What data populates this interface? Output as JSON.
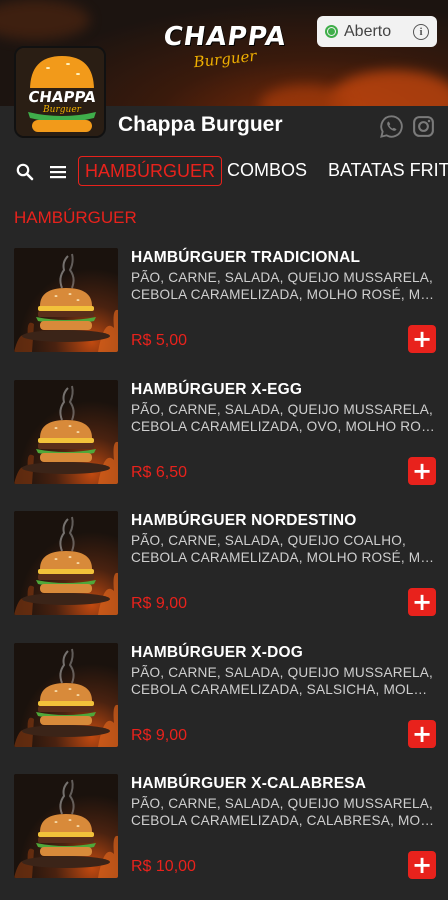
{
  "header": {
    "brand_name": "CHAPPA",
    "brand_sub": "Burguer",
    "status_label": "Aberto",
    "status_icon": "open-dot-icon",
    "store_name": "Chappa Burguer",
    "logo_name": "CHAPPA",
    "logo_sub": "Burguer",
    "colors": {
      "accent": "#e8221c",
      "status_green": "#3fae4a",
      "background": "#262626"
    }
  },
  "nav": {
    "search_icon": "search-icon",
    "menu_icon": "menu-icon",
    "tabs": [
      {
        "label": "HAMBÚRGUER",
        "active": true
      },
      {
        "label": "COMBOS",
        "active": false
      },
      {
        "label": "BATATAS FRITAS",
        "active": false
      }
    ]
  },
  "section": {
    "title": "HAMBÚRGUER"
  },
  "products": [
    {
      "name": "HAMBÚRGUER TRADICIONAL",
      "desc_line1": "PÃO, CARNE, SALADA, QUEIJO MUSSARELA,",
      "desc_line2": "CEBOLA CARAMELIZADA, MOLHO ROSÉ, MOLHO...",
      "price": "R$ 5,00",
      "add_label": "+"
    },
    {
      "name": "HAMBÚRGUER X-EGG",
      "desc_line1": "PÃO, CARNE, SALADA, QUEIJO MUSSARELA,",
      "desc_line2": "CEBOLA CARAMELIZADA, OVO, MOLHO ROSÉ,...",
      "price": "R$ 6,50",
      "add_label": "+"
    },
    {
      "name": "HAMBÚRGUER NORDESTINO",
      "desc_line1": "PÃO, CARNE, SALADA, QUEIJO COALHO,",
      "desc_line2": "CEBOLA CARAMELIZADA, MOLHO ROSÉ, MOLH...",
      "price": "R$ 9,00",
      "add_label": "+"
    },
    {
      "name": "HAMBÚRGUER X-DOG",
      "desc_line1": "PÃO, CARNE, SALADA, QUEIJO MUSSARELA,",
      "desc_line2": "CEBOLA CARAMELIZADA, SALSICHA, MOLHO...",
      "price": "R$ 9,00",
      "add_label": "+"
    },
    {
      "name": "HAMBÚRGUER X-CALABRESA",
      "desc_line1": "PÃO, CARNE, SALADA, QUEIJO MUSSARELA,",
      "desc_line2": "CEBOLA CARAMELIZADA, CALABRESA, MOLHO...",
      "price": "R$ 10,00",
      "add_label": "+"
    }
  ]
}
